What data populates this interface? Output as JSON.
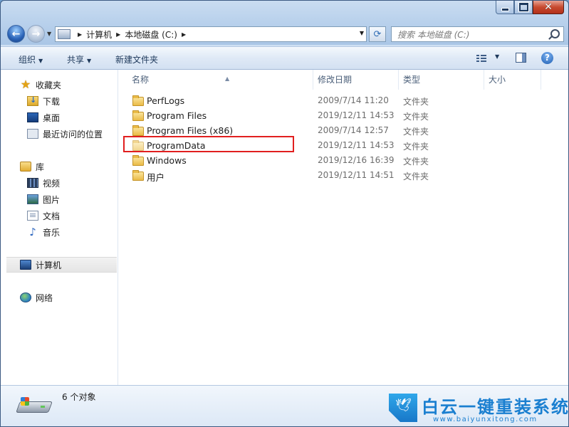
{
  "window": {
    "caption": {
      "close_glyph": "✕"
    }
  },
  "address_bar": {
    "crumbs": [
      "计算机",
      "本地磁盘 (C:)"
    ],
    "search_placeholder": "搜索 本地磁盘 (C:)"
  },
  "command_bar": {
    "organize": "组织",
    "share": "共享",
    "new_folder": "新建文件夹",
    "help": "?"
  },
  "nav": {
    "favorites": {
      "label": "收藏夹",
      "items": [
        "下载",
        "桌面",
        "最近访问的位置"
      ]
    },
    "libraries": {
      "label": "库",
      "items": [
        "视频",
        "图片",
        "文档",
        "音乐"
      ]
    },
    "computer": {
      "label": "计算机"
    },
    "network": {
      "label": "网络"
    }
  },
  "columns": {
    "name": "名称",
    "date": "修改日期",
    "type": "类型",
    "size": "大小"
  },
  "files": [
    {
      "name": "PerfLogs",
      "date": "2009/7/14 11:20",
      "type": "文件夹"
    },
    {
      "name": "Program Files",
      "date": "2019/12/11 14:53",
      "type": "文件夹"
    },
    {
      "name": "Program Files (x86)",
      "date": "2009/7/14 12:57",
      "type": "文件夹"
    },
    {
      "name": "ProgramData",
      "date": "2019/12/11 14:53",
      "type": "文件夹"
    },
    {
      "name": "Windows",
      "date": "2019/12/16 16:39",
      "type": "文件夹"
    },
    {
      "name": "用户",
      "date": "2019/12/11 14:51",
      "type": "文件夹"
    }
  ],
  "details": {
    "count": "6 个对象"
  },
  "watermark": {
    "title": "白云一键重装系统",
    "url": "www.baiyunxitong.com"
  }
}
